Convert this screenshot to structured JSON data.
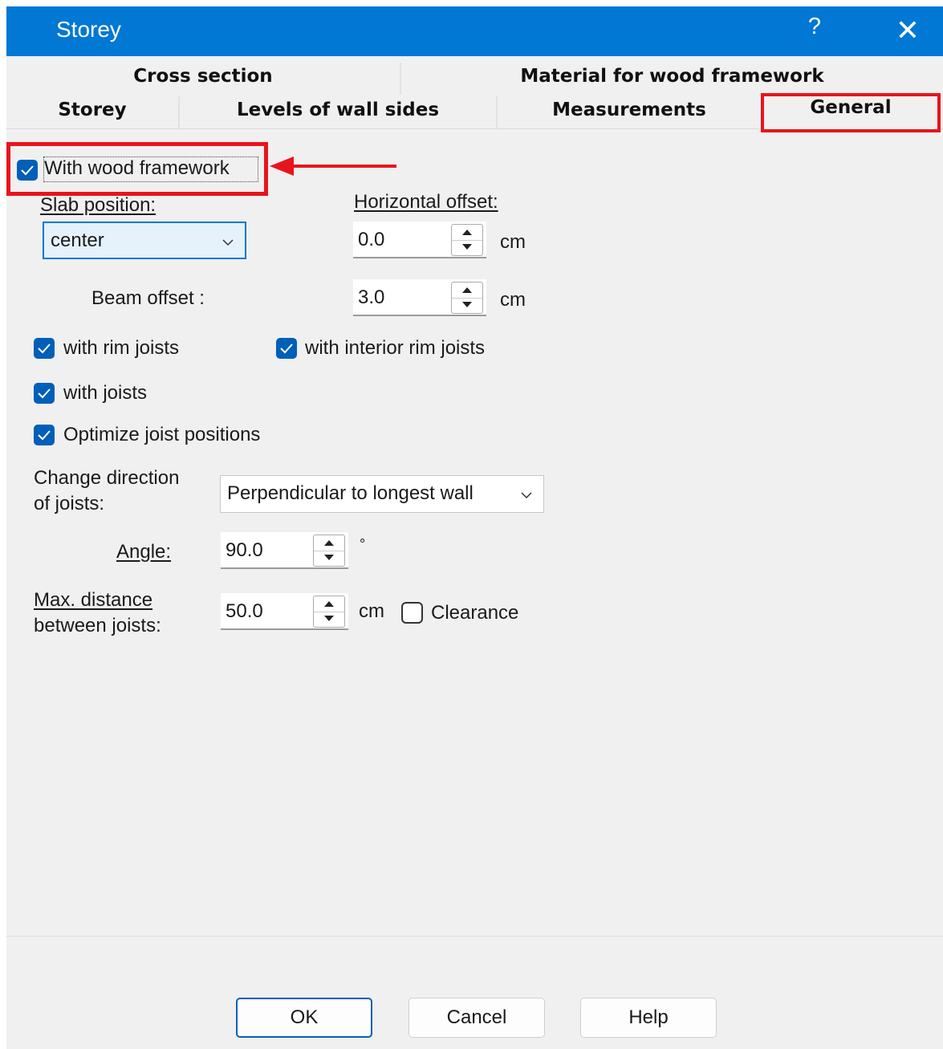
{
  "window": {
    "title": "Storey",
    "help_glyph": "?",
    "close_glyph": "✕"
  },
  "tabs": {
    "row1": [
      "Cross section",
      "Material for wood framework"
    ],
    "row2": [
      "Storey",
      "Levels of wall sides",
      "Measurements",
      "General"
    ],
    "active": "General"
  },
  "general": {
    "with_wood_framework": {
      "label": "With wood framework",
      "checked": true
    },
    "slab_position": {
      "label": "Slab position:",
      "value": "center"
    },
    "horizontal_offset": {
      "label": "Horizontal offset:",
      "value": "0.0",
      "unit": "cm"
    },
    "beam_offset": {
      "label": "Beam offset :",
      "value": "3.0",
      "unit": "cm"
    },
    "with_rim_joists": {
      "label": "with rim joists",
      "checked": true
    },
    "with_interior_rim_joists": {
      "label": "with interior rim joists",
      "checked": true
    },
    "with_joists": {
      "label": "with joists",
      "checked": true
    },
    "optimize_joist_positions": {
      "label": "Optimize joist positions",
      "checked": true
    },
    "change_direction": {
      "label_line1": "Change direction",
      "label_line2": "of joists:",
      "value": "Perpendicular to longest wall"
    },
    "angle": {
      "label": "Angle:",
      "value": "90.0",
      "unit": "°"
    },
    "max_distance": {
      "label_line1": "Max. distance",
      "label_line2": "between joists:",
      "value": "50.0",
      "unit": "cm"
    },
    "clearance": {
      "label": "Clearance",
      "checked": false
    }
  },
  "buttons": {
    "ok": "OK",
    "cancel": "Cancel",
    "help": "Help"
  },
  "annotation_color": "#e8141c",
  "accent_color": "#0078d4"
}
